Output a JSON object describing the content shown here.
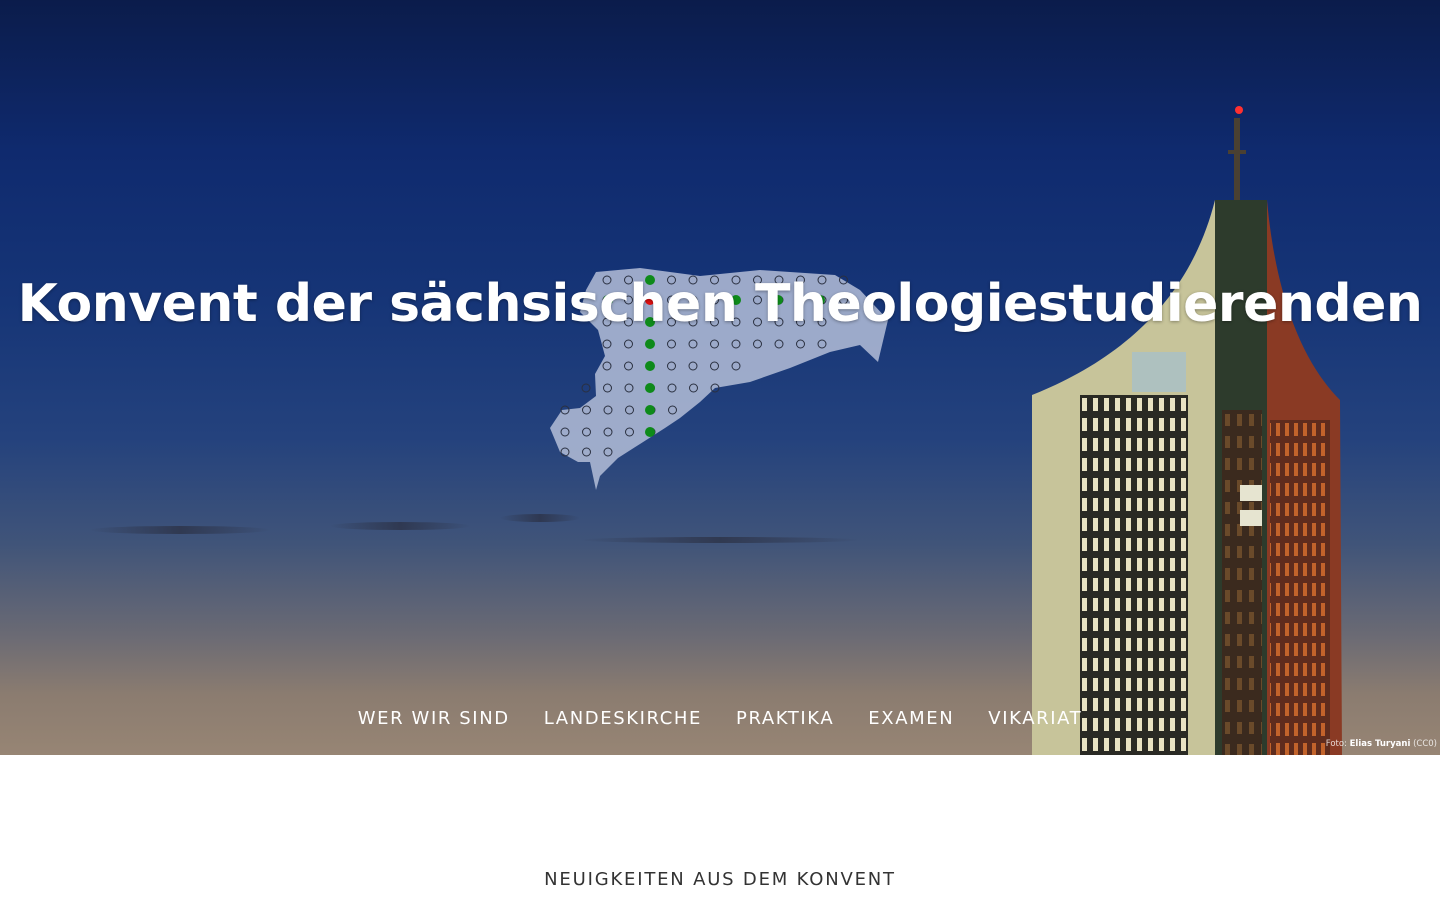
{
  "hero": {
    "title": "Konvent der sächsischen Theologiestudierenden",
    "image_description_icon": "leipzig-city-tower-photo",
    "logo_icon": "saxony-map-dots-logo"
  },
  "nav": {
    "items": [
      {
        "label": "WER WIR SIND"
      },
      {
        "label": "LANDESKIRCHE"
      },
      {
        "label": "PRAKTIKA"
      },
      {
        "label": "EXAMEN"
      },
      {
        "label": "VIKARIAT"
      }
    ]
  },
  "photo_credit": {
    "prefix": "Foto:",
    "author": "Elias Turyani",
    "license": "(CC0)"
  },
  "news": {
    "heading": "NEUIGKEITEN AUS DEM KONVENT"
  },
  "colors": {
    "sky_top": "#0b1c4b",
    "sky_horizon": "#978574",
    "logo_dot_green": "#0e8a1a",
    "logo_dot_red": "#e01010",
    "logo_fill": "#b4bed8"
  }
}
